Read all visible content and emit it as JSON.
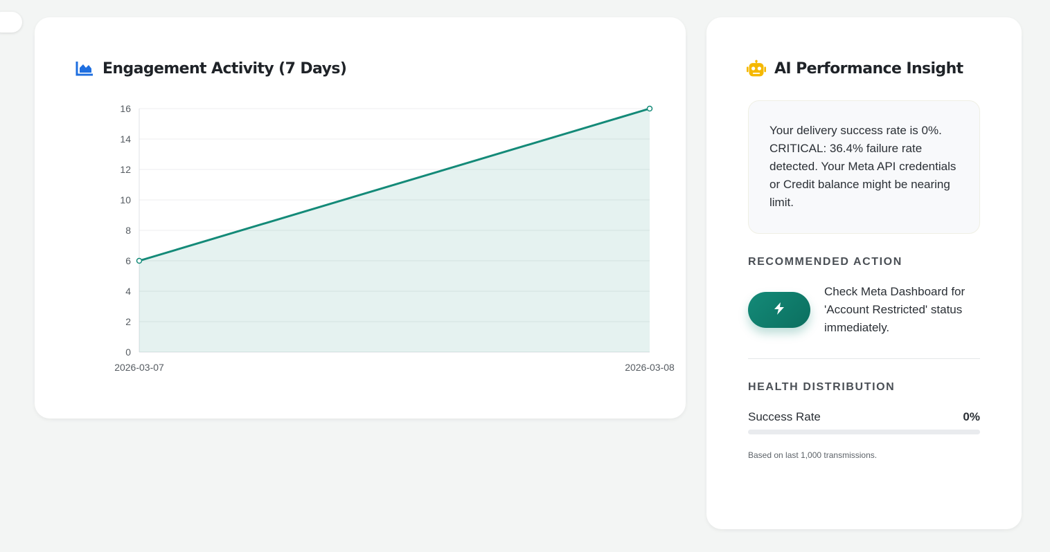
{
  "chart_panel": {
    "title": "Engagement Activity (7 Days)",
    "icon": "area-chart-icon",
    "accent": "#1f6fe0"
  },
  "chart_data": {
    "type": "area",
    "x": [
      "2026-03-07",
      "2026-03-08"
    ],
    "series": [
      {
        "values": [
          6,
          16
        ],
        "color": "#148a78"
      }
    ],
    "yticks": [
      0,
      2,
      4,
      6,
      8,
      10,
      12,
      14,
      16
    ],
    "ylim": [
      0,
      16
    ],
    "grid": true,
    "legend": "none"
  },
  "insight_panel": {
    "title": "AI Performance Insight",
    "icon": "robot-icon",
    "icon_color": "#f5b800",
    "message": "Your delivery success rate is 0%. CRITICAL: 36.4% failure rate detected. Your Meta API credentials or Credit balance might be nearing limit.",
    "recommended_heading": "RECOMMENDED ACTION",
    "action_icon": "lightning-icon",
    "action_text": "Check Meta Dashboard for 'Account Restricted' status immediately.",
    "health_heading": "HEALTH DISTRIBUTION",
    "success_label": "Success Rate",
    "success_value": "0%",
    "success_fraction": 0,
    "footnote": "Based on last 1,000 transmissions.",
    "accent": "#148a78"
  }
}
